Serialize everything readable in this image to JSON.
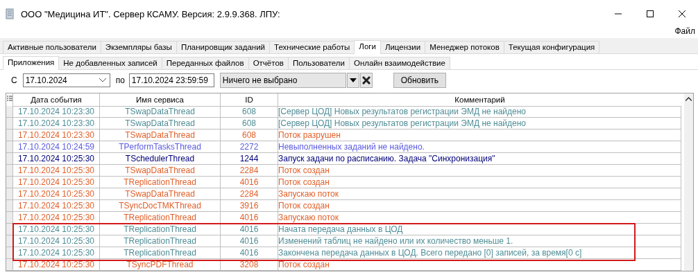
{
  "window": {
    "title": "ООО \"Медицина ИТ\". Сервер КСАМУ. Версия: 2.9.9.368. ЛПУ:"
  },
  "menu": [
    "Файл"
  ],
  "tabs": [
    {
      "label": "Активные пользователи",
      "selected": false
    },
    {
      "label": "Экземпляры базы",
      "selected": false
    },
    {
      "label": "Планировщик заданий",
      "selected": false
    },
    {
      "label": "Технические работы",
      "selected": false
    },
    {
      "label": "Логи",
      "selected": true
    },
    {
      "label": "Лицензии",
      "selected": false
    },
    {
      "label": "Менеджер потоков",
      "selected": false
    },
    {
      "label": "Текущая конфигурация",
      "selected": false
    }
  ],
  "subtabs": [
    {
      "label": "Приложения",
      "selected": true
    },
    {
      "label": "Не добавленных записей",
      "selected": false
    },
    {
      "label": "Переданных файлов",
      "selected": false
    },
    {
      "label": "Отчётов",
      "selected": false
    },
    {
      "label": "Пользователи",
      "selected": false
    },
    {
      "label": "Онлайн взаимодействие",
      "selected": false
    }
  ],
  "filter": {
    "from_label": "С",
    "from": "17.10.2024",
    "to_label": "по",
    "to": "17.10.2024 23:59:59",
    "service": "Ничего не выбрано",
    "refresh": "Обновить"
  },
  "table": {
    "columns": [
      "Дата события",
      "Имя сервиса",
      "ID",
      "Комментарий"
    ],
    "rows": [
      {
        "date": "17.10.2024 10:23:30",
        "service": "TSwapDataThread",
        "id": "608",
        "comment": "[Сервер ЦОД] Новых результатов регистрации ЭМД не найдено",
        "color": "#4f8d96",
        "boxed": false
      },
      {
        "date": "17.10.2024 10:23:30",
        "service": "TSwapDataThread",
        "id": "608",
        "comment": "[Сервер ЦОД] Новых результатов регистрации ЭМД не найдено",
        "color": "#4f8d96",
        "boxed": false
      },
      {
        "date": "17.10.2024 10:23:30",
        "service": "TSwapDataThread",
        "id": "608",
        "comment": "Поток разрушен",
        "color": "#e0602a",
        "boxed": false
      },
      {
        "date": "17.10.2024 10:24:59",
        "service": "TPerformTasksThread",
        "id": "2272",
        "comment": "Невыполненных заданий не найдено.",
        "color": "#5b5be0",
        "boxed": false
      },
      {
        "date": "17.10.2024 10:25:30",
        "service": "TSchedulerThread",
        "id": "1244",
        "comment": "Запуск задачи по расписанию. Задача \"Синхронизация\"",
        "color": "#00007a",
        "boxed": false
      },
      {
        "date": "17.10.2024 10:25:30",
        "service": "TSwapDataThread",
        "id": "2284",
        "comment": "Поток создан",
        "color": "#e0602a",
        "boxed": false
      },
      {
        "date": "17.10.2024 10:25:30",
        "service": "TReplicationThread",
        "id": "4016",
        "comment": "Поток создан",
        "color": "#e0602a",
        "boxed": false
      },
      {
        "date": "17.10.2024 10:25:30",
        "service": "TSwapDataThread",
        "id": "2284",
        "comment": "Запускаю поток",
        "color": "#e0602a",
        "boxed": false
      },
      {
        "date": "17.10.2024 10:25:30",
        "service": "TSyncDocTMKThread",
        "id": "3916",
        "comment": "Поток создан",
        "color": "#e0602a",
        "boxed": false
      },
      {
        "date": "17.10.2024 10:25:30",
        "service": "TReplicationThread",
        "id": "4016",
        "comment": "Запускаю поток",
        "color": "#e0602a",
        "boxed": false
      },
      {
        "date": "17.10.2024 10:25:30",
        "service": "TReplicationThread",
        "id": "4016",
        "comment": "Начата передача данных в ЦОД",
        "color": "#4f8d96",
        "boxed": true
      },
      {
        "date": "17.10.2024 10:25:30",
        "service": "TReplicationThread",
        "id": "4016",
        "comment": "Изменений таблиц не найдено или их количество меньше 1.",
        "color": "#4f8d96",
        "boxed": true
      },
      {
        "date": "17.10.2024 10:25:30",
        "service": "TReplicationThread",
        "id": "4016",
        "comment": "Закончена передача данных в ЦОД. Всего передано [0] записей, за время[0 с]",
        "color": "#4f8d96",
        "boxed": true
      },
      {
        "date": "17.10.2024 10:25:30",
        "service": "TSyncPDFThread",
        "id": "3208",
        "comment": "Поток создан",
        "color": "#e0602a",
        "boxed": false
      }
    ]
  }
}
